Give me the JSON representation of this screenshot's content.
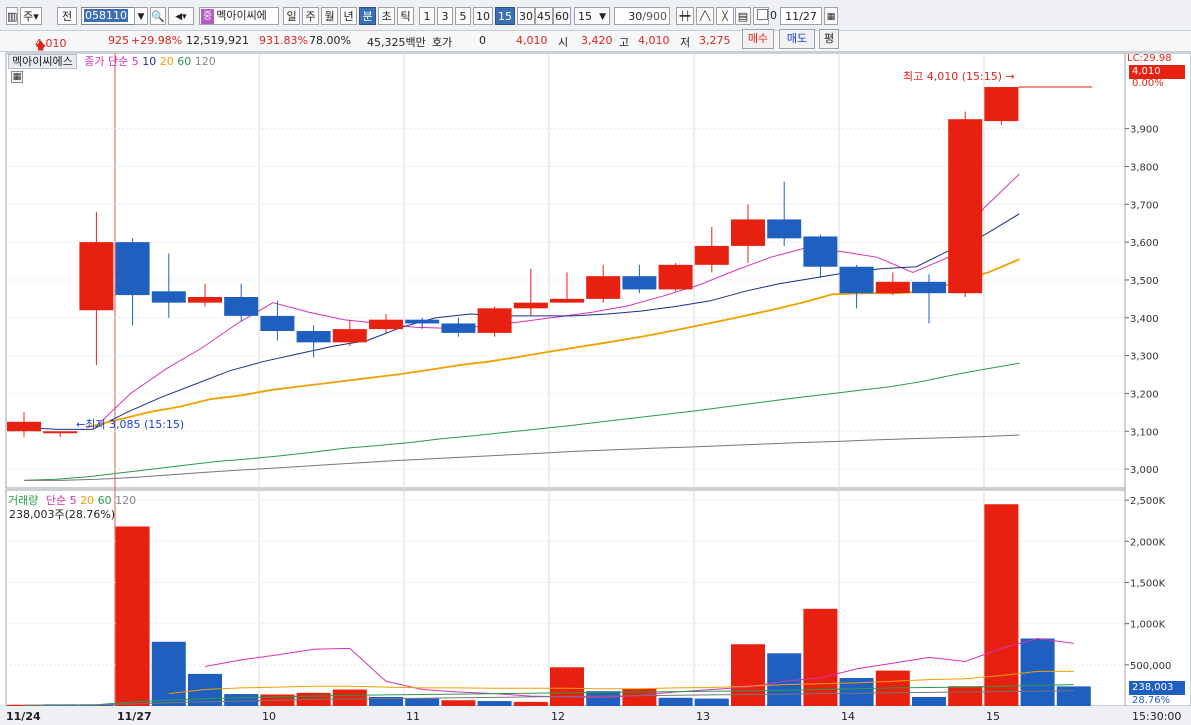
{
  "toolbar": {
    "period_select": "주",
    "prev_btn": "전",
    "code_value": "058110",
    "stock_badge": "중",
    "stock_name": "멕아이씨에",
    "timeframes": [
      "일",
      "주",
      "월",
      "년",
      "분",
      "초",
      "틱"
    ],
    "selected_timeframe": "분",
    "minute_units": [
      "1",
      "3",
      "5",
      "10",
      "15",
      "30",
      "45",
      "60"
    ],
    "selected_minute_unit": "15",
    "unit_select": "15",
    "count_value": "30",
    "count_max": "/900",
    "checkbox_label": "0",
    "date_value": "11/27"
  },
  "infobar": {
    "price": "4,010",
    "change": "925",
    "change_pct": "+29.98%",
    "volume": "12,519,921",
    "vol_ratio": "931.83%",
    "turnover_pct": "78.00%",
    "amount": "45,325백만",
    "hoga_label": "호가",
    "hoga_value": "0",
    "current": "4,010",
    "open_label": "시",
    "open_value": "3,420",
    "high_label": "고",
    "high_value": "4,010",
    "low_label": "저",
    "low_value": "3,275",
    "buy_btn": "매수",
    "sell_btn": "매도",
    "avg_btn": "평"
  },
  "price_legend": {
    "name": "멕아이씨에스",
    "ma_title": "종가 단순",
    "ma_periods": [
      "5",
      "10",
      "20",
      "60",
      "120"
    ]
  },
  "volume_legend": {
    "title": "거래량",
    "ma_title": "단순",
    "ma_periods": [
      "5",
      "20",
      "60",
      "120"
    ],
    "current_volume": "238,003주(28.76%)"
  },
  "annotations": {
    "high": "최고 4,010 (15:15)",
    "low": "최저 3,085 (15:15)"
  },
  "price_boxes": {
    "lc": "LC:29.98",
    "current": "4,010",
    "pct": "0.00%",
    "vol_current": "238,003",
    "vol_pct": "28.76%"
  },
  "dates": [
    "11/24",
    "11/27",
    "10",
    "11",
    "12",
    "13",
    "14",
    "15"
  ],
  "end_time": "15:30:00",
  "colors": {
    "up": "#e8200f",
    "down": "#1f5fbf",
    "ma5": "#d633b5",
    "ma10": "#1a2e8a",
    "ma20": "#f0a000",
    "ma60": "#2a9a4a",
    "ma120": "#777777"
  },
  "chart_data": [
    {
      "type": "candlestick",
      "title": "",
      "ylim": [
        2950,
        4100
      ],
      "yticks": [
        3000,
        3100,
        3200,
        3300,
        3400,
        3500,
        3600,
        3700,
        3800,
        3900
      ],
      "ytick_labels": [
        "3,000",
        "3,100",
        "3,200",
        "3,300",
        "3,400",
        "3,500",
        "3,600",
        "3,700",
        "3,800",
        "3,900"
      ],
      "candles": [
        {
          "o": 3100,
          "h": 3150,
          "l": 3085,
          "c": 3125
        },
        {
          "o": 3095,
          "h": 3100,
          "l": 3085,
          "c": 3100
        },
        {
          "o": 3420,
          "h": 3680,
          "l": 3275,
          "c": 3600
        },
        {
          "o": 3600,
          "h": 3610,
          "l": 3380,
          "c": 3460
        },
        {
          "o": 3470,
          "h": 3570,
          "l": 3400,
          "c": 3440
        },
        {
          "o": 3440,
          "h": 3490,
          "l": 3430,
          "c": 3455
        },
        {
          "o": 3455,
          "h": 3490,
          "l": 3390,
          "c": 3405
        },
        {
          "o": 3405,
          "h": 3445,
          "l": 3340,
          "c": 3365
        },
        {
          "o": 3365,
          "h": 3380,
          "l": 3295,
          "c": 3335
        },
        {
          "o": 3335,
          "h": 3395,
          "l": 3325,
          "c": 3370
        },
        {
          "o": 3370,
          "h": 3410,
          "l": 3360,
          "c": 3395
        },
        {
          "o": 3395,
          "h": 3400,
          "l": 3370,
          "c": 3385
        },
        {
          "o": 3385,
          "h": 3400,
          "l": 3350,
          "c": 3360
        },
        {
          "o": 3360,
          "h": 3430,
          "l": 3350,
          "c": 3425
        },
        {
          "o": 3425,
          "h": 3530,
          "l": 3405,
          "c": 3440
        },
        {
          "o": 3440,
          "h": 3520,
          "l": 3440,
          "c": 3450
        },
        {
          "o": 3450,
          "h": 3540,
          "l": 3440,
          "c": 3510
        },
        {
          "o": 3510,
          "h": 3540,
          "l": 3465,
          "c": 3475
        },
        {
          "o": 3475,
          "h": 3545,
          "l": 3470,
          "c": 3540
        },
        {
          "o": 3540,
          "h": 3640,
          "l": 3520,
          "c": 3590
        },
        {
          "o": 3590,
          "h": 3700,
          "l": 3545,
          "c": 3660
        },
        {
          "o": 3660,
          "h": 3760,
          "l": 3590,
          "c": 3610
        },
        {
          "o": 3615,
          "h": 3620,
          "l": 3505,
          "c": 3535
        },
        {
          "o": 3535,
          "h": 3540,
          "l": 3425,
          "c": 3465
        },
        {
          "o": 3465,
          "h": 3520,
          "l": 3460,
          "c": 3495
        },
        {
          "o": 3495,
          "h": 3515,
          "l": 3385,
          "c": 3465
        },
        {
          "o": 3465,
          "h": 3945,
          "l": 3455,
          "c": 3925
        },
        {
          "o": 3920,
          "h": 4010,
          "l": 3910,
          "c": 4010
        }
      ],
      "ma": [
        {
          "period": "5",
          "values": [
            null,
            null,
            3110,
            3200,
            3265,
            3320,
            3385,
            3440,
            3415,
            3395,
            3385,
            3375,
            3372,
            3378,
            3390,
            3402,
            3415,
            3432,
            3458,
            3487,
            3525,
            3560,
            3585,
            3575,
            3560,
            3520,
            3560,
            3690,
            3780
          ]
        },
        {
          "period": "10",
          "values": [
            3110,
            3105,
            3105,
            3150,
            3190,
            3225,
            3260,
            3285,
            3305,
            3325,
            3340,
            3375,
            3400,
            3410,
            3405,
            3405,
            3405,
            3410,
            3418,
            3430,
            3445,
            3470,
            3490,
            3505,
            3520,
            3530,
            3535,
            3580,
            3620,
            3675
          ]
        },
        {
          "period": "20",
          "values": [
            null,
            null,
            3110,
            3130,
            3150,
            3165,
            3185,
            3195,
            3210,
            3220,
            3230,
            3240,
            3250,
            3262,
            3275,
            3285,
            3298,
            3312,
            3325,
            3338,
            3352,
            3368,
            3385,
            3402,
            3420,
            3440,
            3462,
            3465,
            3465,
            3470,
            3495,
            3520,
            3555
          ]
        },
        {
          "period": "60",
          "values": [
            2970,
            2973,
            2980,
            2990,
            3000,
            3010,
            3020,
            3027,
            3035,
            3045,
            3055,
            3062,
            3070,
            3080,
            3088,
            3097,
            3106,
            3115,
            3125,
            3135,
            3145,
            3155,
            3166,
            3177,
            3188,
            3198,
            3208,
            3218,
            3232,
            3250,
            3265,
            3280
          ]
        },
        {
          "period": "120",
          "values": [
            2970,
            2970,
            2973,
            2978,
            2985,
            2992,
            2998,
            3004,
            3010,
            3016,
            3022,
            3027,
            3032,
            3037,
            3042,
            3047,
            3051,
            3055,
            3058,
            3062,
            3066,
            3070,
            3073,
            3077,
            3080,
            3083,
            3086,
            3090
          ]
        }
      ]
    },
    {
      "type": "bar",
      "title": "거래량",
      "ylim": [
        0,
        2550000
      ],
      "yticks": [
        500000,
        1000000,
        1500000,
        2000000,
        2500000
      ],
      "ytick_labels": [
        "500,000",
        "1,000K",
        "1,500K",
        "2,000K",
        "2,500K"
      ],
      "values": [
        15000,
        20000,
        20000,
        2180000,
        780000,
        390000,
        145000,
        140000,
        160000,
        200000,
        110000,
        90000,
        70000,
        60000,
        50000,
        470000,
        180000,
        210000,
        100000,
        90000,
        750000,
        640000,
        1180000,
        340000,
        430000,
        110000,
        240000,
        2450000,
        820000,
        238000
      ],
      "directions": [
        "up",
        "down",
        "down",
        "up",
        "down",
        "down",
        "down",
        "up",
        "up",
        "up",
        "down",
        "down",
        "up",
        "down",
        "up",
        "up",
        "down",
        "up",
        "down",
        "down",
        "up",
        "down",
        "up",
        "down",
        "up",
        "down",
        "up",
        "up",
        "down",
        "down"
      ],
      "ma5": [
        null,
        null,
        null,
        null,
        null,
        480000,
        560000,
        620000,
        690000,
        700000,
        300000,
        200000,
        170000,
        150000,
        120000,
        110000,
        100000,
        130000,
        170000,
        200000,
        230000,
        300000,
        340000,
        450000,
        520000,
        590000,
        540000,
        700000,
        820000,
        760000
      ],
      "ma20": [
        null,
        null,
        null,
        null,
        150000,
        200000,
        220000,
        230000,
        240000,
        240000,
        230000,
        220000,
        220000,
        215000,
        215000,
        215000,
        210000,
        210000,
        220000,
        225000,
        240000,
        260000,
        270000,
        280000,
        300000,
        320000,
        330000,
        370000,
        420000,
        420000
      ],
      "ma60": [
        10000,
        12000,
        15000,
        50000,
        70000,
        90000,
        100000,
        110000,
        120000,
        130000,
        135000,
        140000,
        145000,
        150000,
        155000,
        160000,
        165000,
        170000,
        175000,
        180000,
        185000,
        190000,
        200000,
        210000,
        220000,
        225000,
        230000,
        240000,
        250000,
        260000
      ],
      "ma120": [
        10000,
        11000,
        12000,
        25000,
        40000,
        50000,
        60000,
        70000,
        80000,
        85000,
        90000,
        95000,
        100000,
        105000,
        110000,
        115000,
        120000,
        125000,
        130000,
        135000,
        140000,
        145000,
        150000,
        155000,
        160000,
        165000,
        170000,
        175000,
        180000,
        185000
      ]
    }
  ]
}
